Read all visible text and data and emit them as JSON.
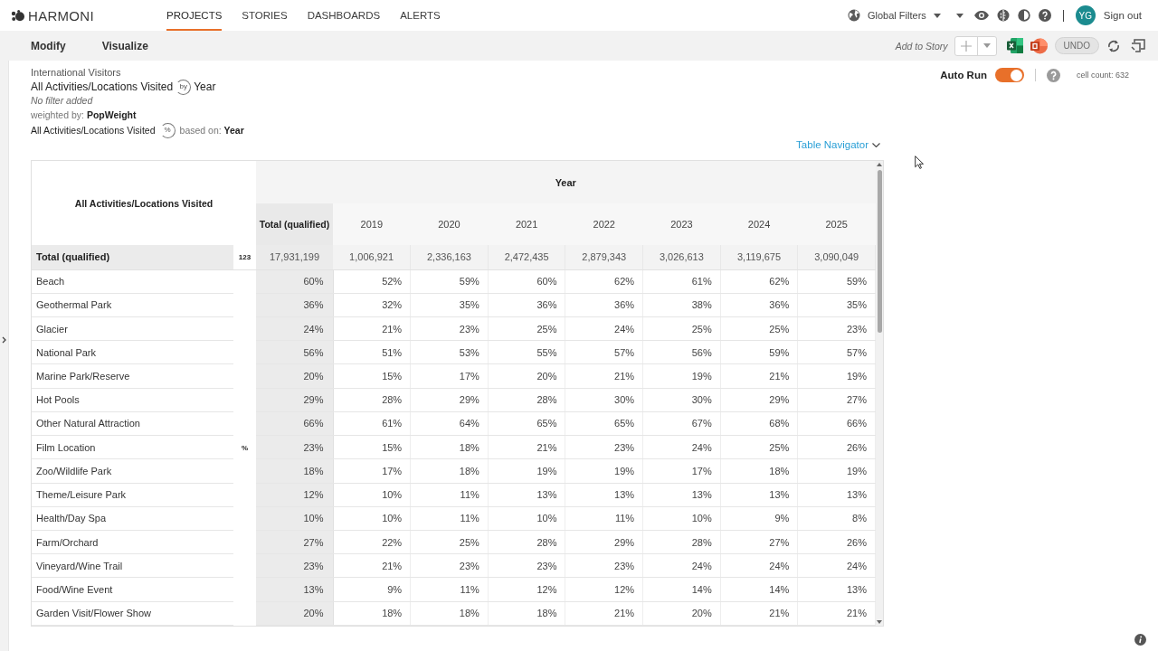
{
  "brand": {
    "name": "HARMONI"
  },
  "nav": [
    {
      "label": "PROJECTS",
      "selected": true
    },
    {
      "label": "STORIES",
      "selected": false
    },
    {
      "label": "DASHBOARDS",
      "selected": false
    },
    {
      "label": "ALERTS",
      "selected": false
    }
  ],
  "user_menu": {
    "global_filters": "Global Filters",
    "avatar": "YG",
    "sign_out": "Sign out"
  },
  "toolbar": {
    "tabs": [
      {
        "label": "Modify"
      },
      {
        "label": "Visualize"
      }
    ],
    "add_to_story": "Add to Story",
    "undo": {
      "label": "UNDO",
      "disabled": true
    }
  },
  "report": {
    "dataset": "International Visitors",
    "row_variable": "All Activities/Locations Visited",
    "by": "by",
    "column_variable": "Year",
    "filter": "No filter added",
    "weight": "weighted by: **PopWeight**",
    "percent_variable": "All Activities/Locations Visited",
    "percent": "%",
    "based_on": "based on: **Year**"
  },
  "run_panel": {
    "auto_run": {
      "label": "Auto Run",
      "on": true
    },
    "cell_count": "cell count: 632"
  },
  "table_navigator": "Table Navigator",
  "table": {
    "corner": "All Activities/Locations Visited",
    "column_group": "Year",
    "columns": [
      "Total (qualified)",
      "2019",
      "2020",
      "2021",
      "2022",
      "2023",
      "2024",
      "2025"
    ],
    "total_row": {
      "label": "Total (qualified)",
      "base": "123",
      "values": [
        "17,931,199",
        "1,006,921",
        "2,336,163",
        "2,472,435",
        "2,879,343",
        "3,026,613",
        "3,119,675",
        "3,090,049"
      ]
    },
    "statistic": "%",
    "rows": [
      {
        "label": "Beach",
        "values": [
          "60%",
          "52%",
          "59%",
          "60%",
          "62%",
          "61%",
          "62%",
          "59%"
        ]
      },
      {
        "label": "Geothermal Park",
        "values": [
          "36%",
          "32%",
          "35%",
          "36%",
          "36%",
          "38%",
          "36%",
          "35%"
        ]
      },
      {
        "label": "Glacier",
        "values": [
          "24%",
          "21%",
          "23%",
          "25%",
          "24%",
          "25%",
          "25%",
          "23%"
        ]
      },
      {
        "label": "National Park",
        "values": [
          "56%",
          "51%",
          "53%",
          "55%",
          "57%",
          "56%",
          "59%",
          "57%"
        ]
      },
      {
        "label": "Marine Park/Reserve",
        "values": [
          "20%",
          "15%",
          "17%",
          "20%",
          "21%",
          "19%",
          "21%",
          "19%"
        ]
      },
      {
        "label": "Hot Pools",
        "values": [
          "29%",
          "28%",
          "29%",
          "28%",
          "30%",
          "30%",
          "29%",
          "27%"
        ]
      },
      {
        "label": "Other Natural Attraction",
        "values": [
          "66%",
          "61%",
          "64%",
          "65%",
          "65%",
          "67%",
          "68%",
          "66%"
        ]
      },
      {
        "label": "Film Location",
        "values": [
          "23%",
          "15%",
          "18%",
          "21%",
          "23%",
          "24%",
          "25%",
          "26%"
        ]
      },
      {
        "label": "Zoo/Wildlife Park",
        "values": [
          "18%",
          "17%",
          "18%",
          "19%",
          "19%",
          "17%",
          "18%",
          "19%"
        ]
      },
      {
        "label": "Theme/Leisure Park",
        "values": [
          "12%",
          "10%",
          "11%",
          "13%",
          "13%",
          "13%",
          "13%",
          "13%"
        ]
      },
      {
        "label": "Health/Day Spa",
        "values": [
          "10%",
          "10%",
          "11%",
          "10%",
          "11%",
          "10%",
          "9%",
          "8%"
        ]
      },
      {
        "label": "Farm/Orchard",
        "values": [
          "27%",
          "22%",
          "25%",
          "28%",
          "29%",
          "28%",
          "27%",
          "26%"
        ]
      },
      {
        "label": "Vineyard/Wine Trail",
        "values": [
          "23%",
          "21%",
          "23%",
          "23%",
          "23%",
          "24%",
          "24%",
          "24%"
        ]
      },
      {
        "label": "Food/Wine Event",
        "values": [
          "13%",
          "9%",
          "11%",
          "12%",
          "12%",
          "14%",
          "14%",
          "13%"
        ]
      },
      {
        "label": "Garden Visit/Flower Show",
        "values": [
          "20%",
          "18%",
          "18%",
          "18%",
          "21%",
          "20%",
          "21%",
          "21%"
        ]
      }
    ]
  }
}
